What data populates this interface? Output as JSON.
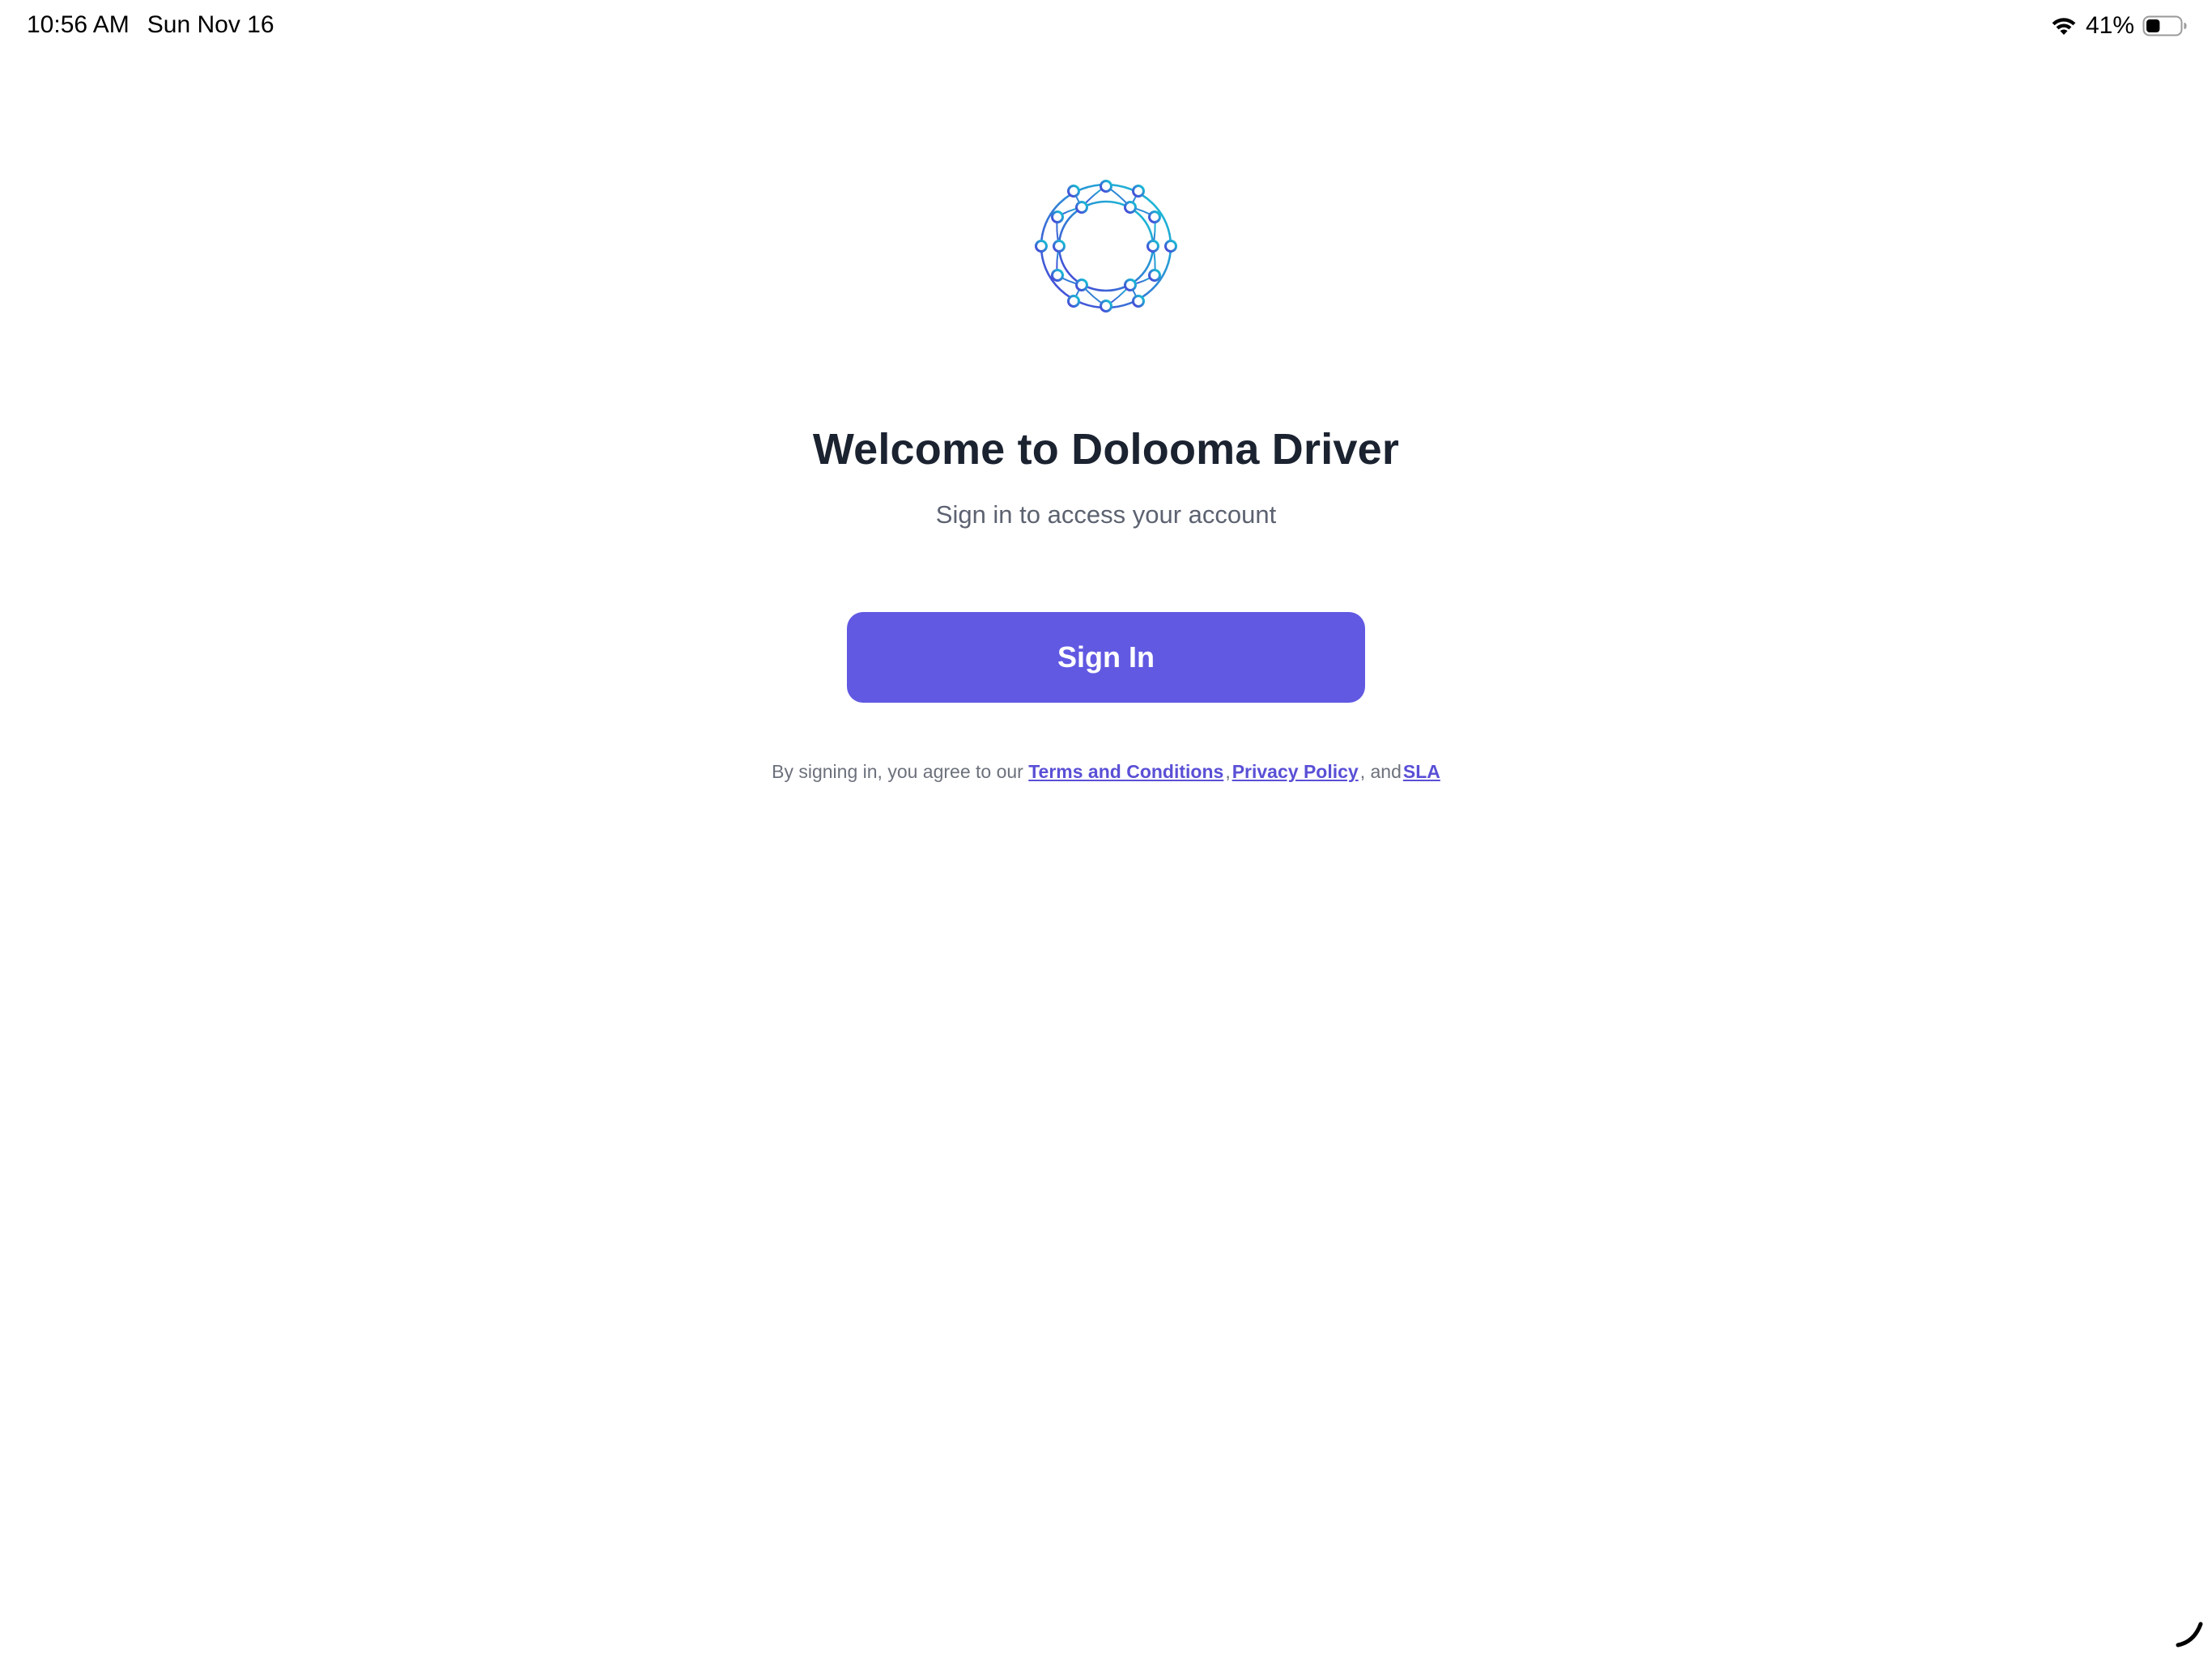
{
  "status_bar": {
    "time": "10:56 AM",
    "date": "Sun Nov 16",
    "battery_percent": "41%",
    "battery_level": 0.41,
    "wifi_icon": "wifi-icon",
    "battery_icon": "battery-icon"
  },
  "logo": {
    "icon": "network-ring-logo-icon",
    "gradient_start": "#14c8d4",
    "gradient_end": "#4b3fd8"
  },
  "welcome": {
    "title": "Welcome to Dolooma Driver",
    "subtitle": "Sign in to access your account"
  },
  "signin": {
    "label": "Sign In",
    "color": "#6159e2"
  },
  "legal": {
    "prefix": "By signing in, you agree to our",
    "terms_label": "Terms and Conditions",
    "comma": ",",
    "privacy_label": "Privacy Policy",
    "and": ", and",
    "sla_label": "SLA",
    "link_color": "#5a50d6"
  }
}
